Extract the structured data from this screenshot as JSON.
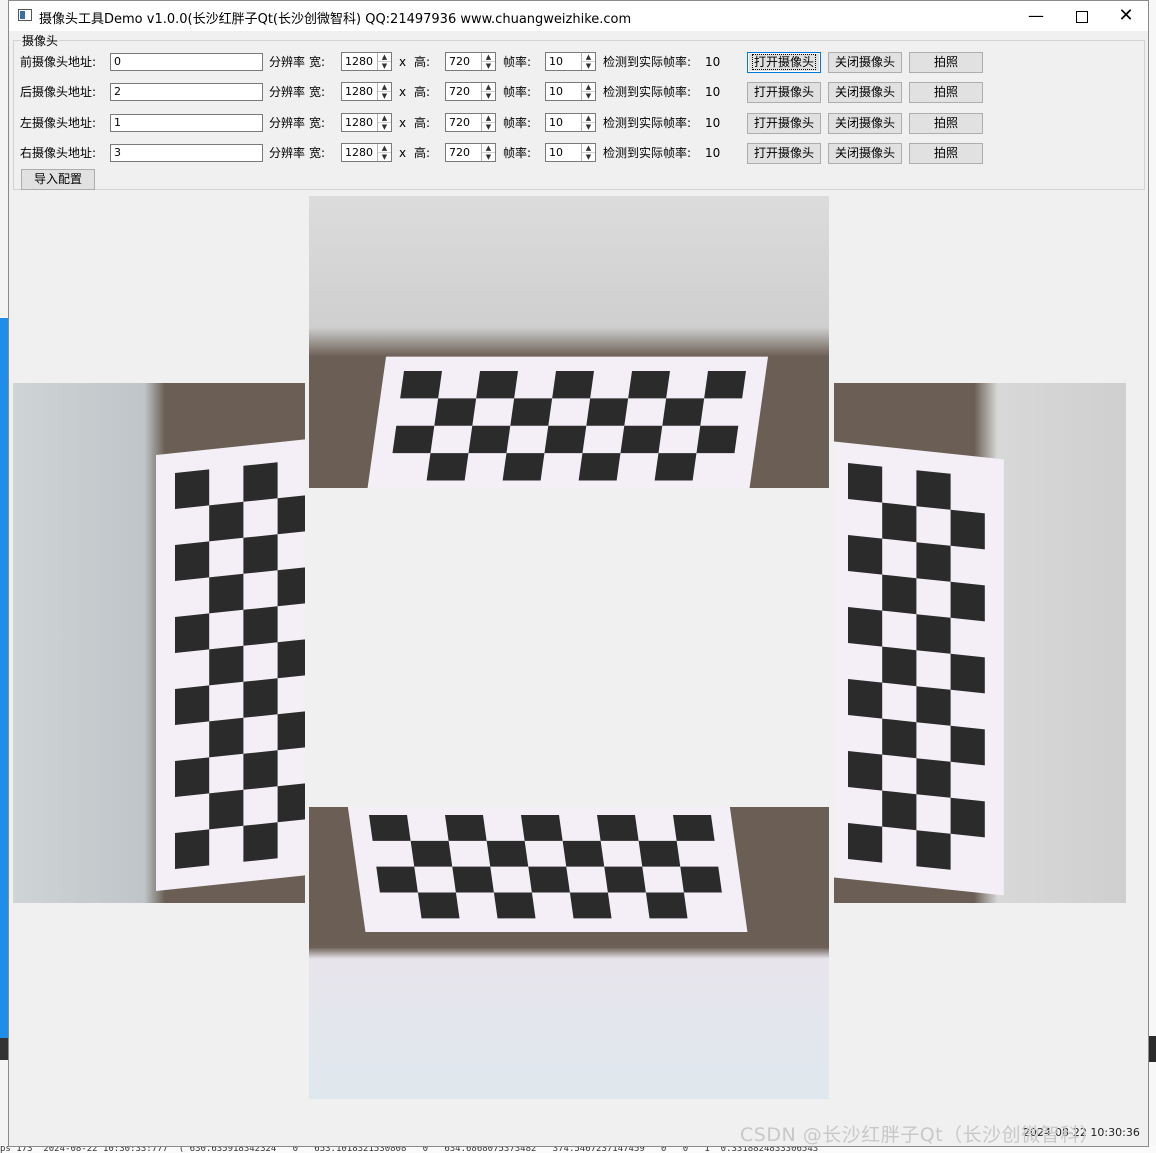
{
  "window": {
    "title": "摄像头工具Demo v1.0.0(长沙红胖子Qt(长沙创微智科) QQ:21497936 www.chuangweizhike.com",
    "minimize_glyph": "—",
    "close_glyph": "✕"
  },
  "group": {
    "title": "摄像头"
  },
  "labels": {
    "resolution": "分辨率",
    "width": "宽:",
    "times": "x",
    "height": "高:",
    "fps": "帧率:",
    "detected_fps": "检测到实际帧率:",
    "open": "打开摄像头",
    "close": "关闭摄像头",
    "snapshot": "拍照",
    "spin_up": "▲",
    "spin_down": "▼"
  },
  "cameras": [
    {
      "label": "前摄像头地址:",
      "address": "0",
      "width": "1280",
      "height": "720",
      "fps": "10",
      "actual_fps": "10"
    },
    {
      "label": "后摄像头地址:",
      "address": "2",
      "width": "1280",
      "height": "720",
      "fps": "10",
      "actual_fps": "10"
    },
    {
      "label": "左摄像头地址:",
      "address": "1",
      "width": "1280",
      "height": "720",
      "fps": "10",
      "actual_fps": "10"
    },
    {
      "label": "右摄像头地址:",
      "address": "3",
      "width": "1280",
      "height": "720",
      "fps": "10",
      "actual_fps": "10"
    }
  ],
  "import_button": "导入配置",
  "overlay": {
    "watermark": "CSDN @长沙红胖子Qt（长沙创微智科）",
    "timestamp": "2024-08-22 10:30:36"
  },
  "background": {
    "bottom_log": "ps 173 \"2024-08-22 10:30:33:777\" (\"630.635918342324\" \"0\" \"653.1018321530808\" \"0\" \"634.6868075373482\" \"374.5467237147459\" \"0\" \"0\" \"1\" 0.3318824833306543"
  },
  "colors": {
    "window_bg": "#f0f0f0",
    "focus_border": "#0078d7",
    "checker_dark": "#2b2b2b",
    "checker_light": "#f4eef6"
  }
}
